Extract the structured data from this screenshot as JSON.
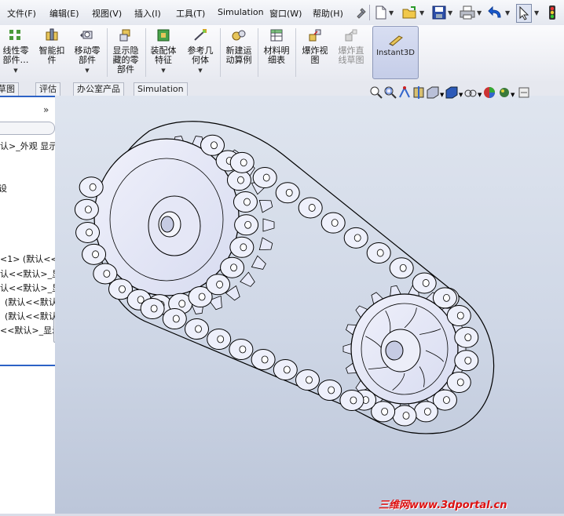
{
  "menubar": {
    "items": [
      "文件(F)",
      "编辑(E)",
      "视图(V)",
      "插入(I)",
      "工具(T)",
      "Simulation",
      "窗口(W)",
      "帮助(H)"
    ]
  },
  "ribbon": {
    "buttons": [
      {
        "label_line1": "线性零",
        "label_line2": "部件…",
        "icon": "linear-pattern-icon"
      },
      {
        "label_line1": "智能扣",
        "label_line2": "件",
        "icon": "smart-fastener-icon"
      },
      {
        "label_line1": "移动零",
        "label_line2": "部件",
        "icon": "move-component-icon"
      },
      {
        "label_line1": "显示隐",
        "label_line2": "藏的零",
        "label_line3": "部件",
        "icon": "show-hidden-icon"
      },
      {
        "label_line1": "装配体",
        "label_line2": "特征",
        "icon": "assembly-feature-icon"
      },
      {
        "label_line1": "参考几",
        "label_line2": "何体",
        "icon": "reference-geometry-icon"
      },
      {
        "label_line1": "新建运",
        "label_line2": "动算例",
        "icon": "motion-study-icon"
      },
      {
        "label_line1": "材料明",
        "label_line2": "细表",
        "icon": "bom-icon"
      },
      {
        "label_line1": "爆炸视",
        "label_line2": "图",
        "icon": "exploded-view-icon"
      },
      {
        "label_line1": "爆炸直",
        "label_line2": "线草图",
        "icon": "explode-line-sketch-icon"
      }
    ],
    "instant3d_label": "Instant3D"
  },
  "tabs": [
    "草图",
    "评估",
    "办公室产品",
    "Simulation"
  ],
  "panel": {
    "collapse_label": "»",
    "rows": [
      "认>_外观 显示",
      "设",
      "<1> (默认<<默",
      "认<<默认>_显",
      "认<<默认>_显",
      "(默认<<默认",
      "(默认<<默认",
      "<<默认>_显示"
    ]
  },
  "watermark": "三维网www.3dportal.cn",
  "colors": {
    "viewport_top": "#dfe5ef",
    "viewport_bottom": "#bcc6d9",
    "part_fill": "#e8eaf8",
    "edge": "#000000",
    "watermark": "#dd1111"
  }
}
